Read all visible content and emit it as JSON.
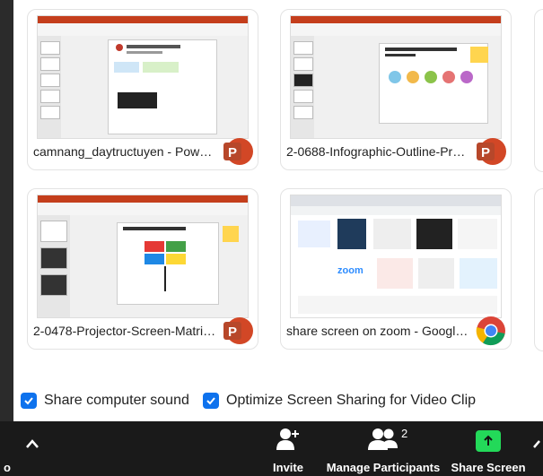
{
  "cards": [
    {
      "label": "camnang_daytructuyen - PowerP...",
      "app": "powerpoint"
    },
    {
      "label": "2-0688-Infographic-Outline-Proc...",
      "app": "powerpoint"
    },
    {
      "label": "2-0478-Projector-Screen-Matrix-...",
      "app": "powerpoint"
    },
    {
      "label": "share screen on zoom - Google T...",
      "app": "chrome"
    }
  ],
  "options": {
    "share_sound": {
      "label": "Share computer sound",
      "checked": true
    },
    "optimize_video": {
      "label": "Optimize Screen Sharing for Video Clip",
      "checked": true
    }
  },
  "toolbar": {
    "invite_label": "Invite",
    "participants_label": "Manage Participants",
    "participants_count": "2",
    "share_label": "Share Screen",
    "left_char": "o"
  },
  "icons": {
    "powerpoint": "powerpoint-icon",
    "chrome": "chrome-icon",
    "caret": "chevron-up-icon"
  },
  "colors": {
    "accent": "#0e72ed",
    "powerpoint": "#d24726",
    "share_green": "#23d959",
    "toolbar_bg": "#1a1a1a"
  }
}
